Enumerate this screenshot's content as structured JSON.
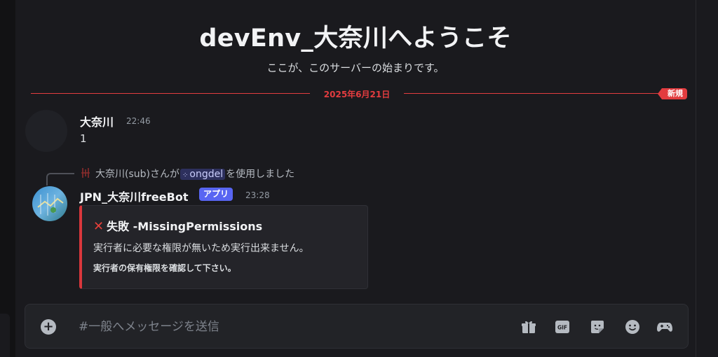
{
  "welcome": {
    "title": "devEnv_大奈川へようこそ",
    "subtitle": "ここが、このサーバーの始まりです。"
  },
  "divider": {
    "date": "2025年6月21日",
    "new_label": "新規"
  },
  "message1": {
    "author": "大奈川",
    "time": "22:46",
    "content": "1"
  },
  "reply": {
    "user": "大奈川(sub)",
    "text_before": "さんが",
    "command": "ongdel",
    "text_after": "を使用しました"
  },
  "message2": {
    "author": "JPN_大奈川freeBot",
    "badge": "アプリ",
    "time": "23:28",
    "embed": {
      "title": "失敗 -MissingPermissions",
      "line1": "実行者に必要な権限が無いため実行出来ません。",
      "line2": "実行者の保有権限を確認して下さい。",
      "accent_color": "#da373c"
    }
  },
  "composer": {
    "placeholder": "#一般へメッセージを送信",
    "value": "",
    "tools": [
      "gift-icon",
      "gif-icon",
      "sticker-icon",
      "emoji-icon",
      "game-icon"
    ]
  },
  "colors": {
    "background": "#1a1a1e",
    "new_divider": "#e23c3f",
    "blurple": "#5865f2"
  }
}
